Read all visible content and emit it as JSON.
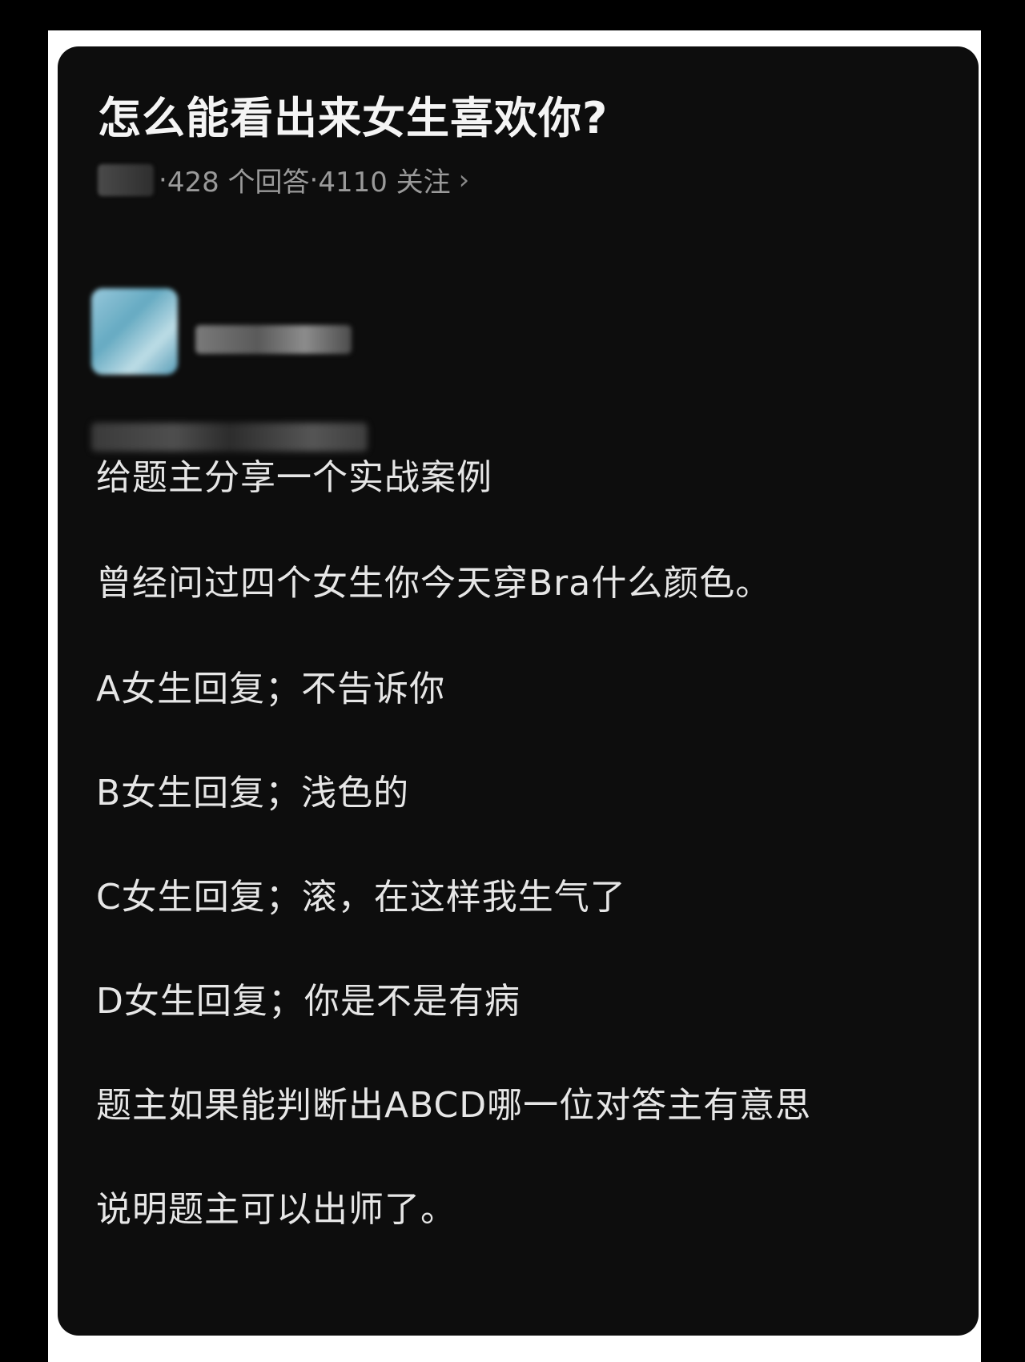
{
  "question": {
    "title": "怎么能看出来女生喜欢你?",
    "answers_count": "428 个回答",
    "followers_count": "4110 关注",
    "separator": "·",
    "chevron": "›"
  },
  "answer": {
    "paragraphs": [
      "给题主分享一个实战案例",
      "曾经问过四个女生你今天穿Bra什么颜色。",
      "A女生回复；不告诉你",
      "B女生回复；浅色的",
      "C女生回复；滚，在这样我生气了",
      "D女生回复；你是不是有病",
      "题主如果能判断出ABCD哪一位对答主有意思",
      "说明题主可以出师了。"
    ]
  },
  "colors": {
    "background": "#000000",
    "frame": "#ffffff",
    "card": "#0d0d0d",
    "text": "#e6e6e6",
    "meta_text": "#9a9a9a"
  }
}
